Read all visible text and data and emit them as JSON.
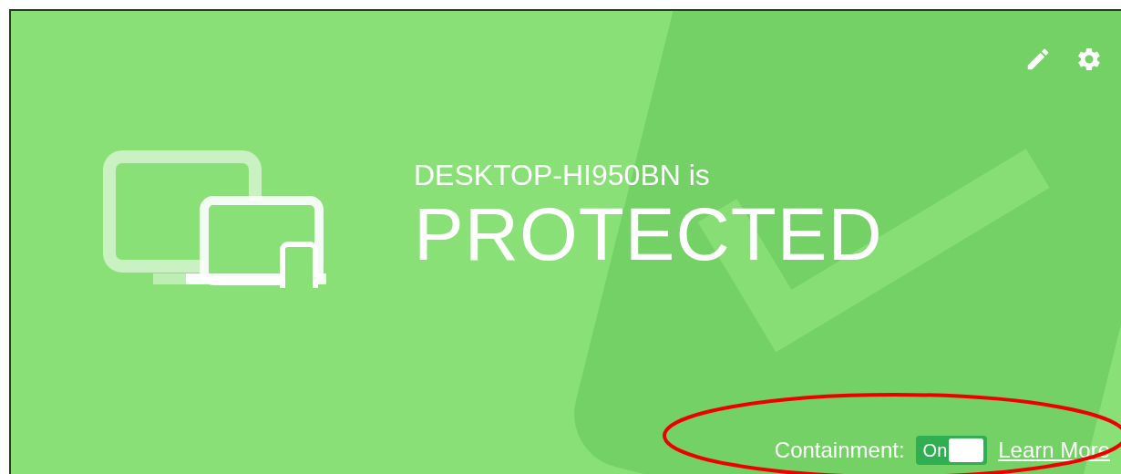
{
  "device": {
    "name_line": "DESKTOP-HI950BN is",
    "status": "PROTECTED"
  },
  "containment": {
    "label": "Containment:",
    "toggle": {
      "text": "On",
      "on": true
    },
    "link": "Learn More"
  }
}
